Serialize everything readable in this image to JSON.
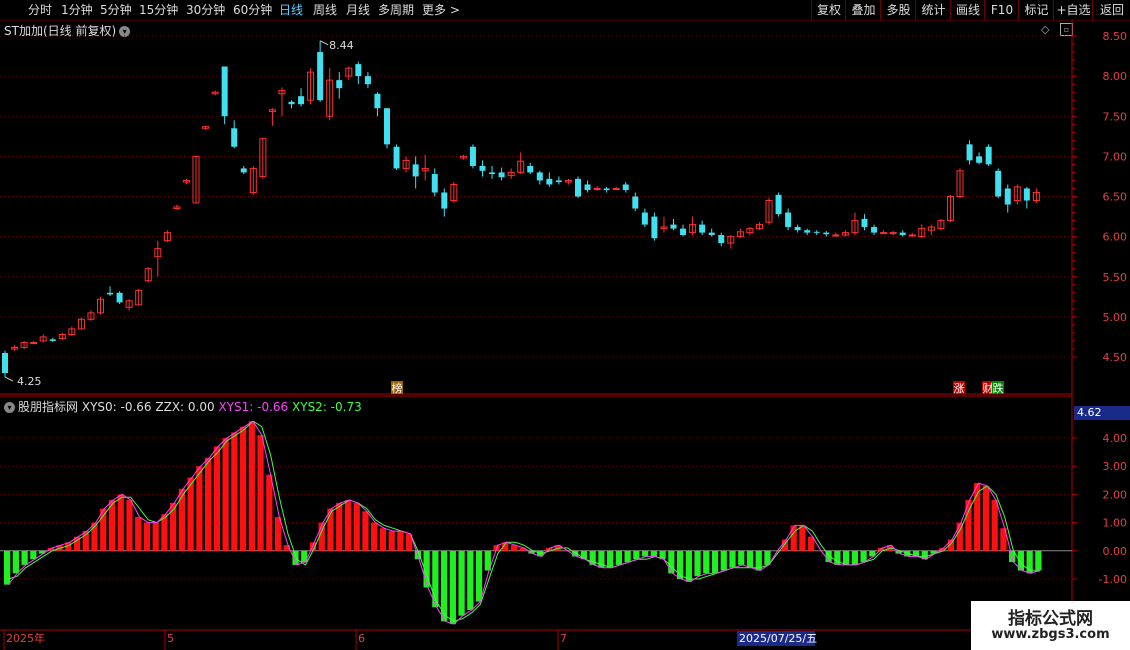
{
  "toolbar": {
    "tabs": [
      "分时",
      "1分钟",
      "5分钟",
      "15分钟",
      "30分钟",
      "60分钟",
      "日线",
      "周线",
      "月线",
      "多周期",
      "更多"
    ],
    "active_tab": "日线",
    "more_arrow": ">",
    "right_buttons": [
      "复权",
      "叠加",
      "多股",
      "统计",
      "画线",
      "F10",
      "标记",
      "+自选",
      "返回"
    ]
  },
  "main_chart": {
    "title": "ST加加(日线 前复权)",
    "high_label": "8.44",
    "low_label": "4.25",
    "y_ticks": [
      "8.50",
      "8.00",
      "7.50",
      "7.00",
      "6.50",
      "6.00",
      "5.50",
      "5.00",
      "4.50"
    ],
    "markers": [
      {
        "text": "榜",
        "color": "#e0a000"
      },
      {
        "text": "涨",
        "color": "#ff3030"
      },
      {
        "text": "财",
        "color": "#ff3030"
      },
      {
        "text": "跌",
        "color": "#00ff20"
      }
    ]
  },
  "indicator": {
    "name": "股朋指标网",
    "xys0": "XYS0: -0.66",
    "zzx": "ZZX: 0.00",
    "xys1": "XYS1: -0.66",
    "xys2": "XYS2: -0.73",
    "current_value": "4.62",
    "y_ticks": [
      "4.00",
      "3.00",
      "2.00",
      "1.00",
      "0.00",
      "-1.00"
    ]
  },
  "time_axis": {
    "labels": [
      "2025年",
      "5",
      "6",
      "7"
    ],
    "cursor_label": "2025/07/25/五"
  },
  "watermark": {
    "line1": "指标公式网",
    "line2": "www.zbgs3.com"
  },
  "colors": {
    "up": "#ff3030",
    "down": "#40e0f0",
    "hist_up": "#ff1010",
    "hist_down": "#20f020",
    "xys1": "#ff40ff",
    "xys2": "#40ff40",
    "axis": "#b00000"
  },
  "chart_data": {
    "type": "candlestick",
    "ylim": [
      4.2,
      8.6
    ],
    "candles": [
      [
        4.55,
        4.3,
        4.58,
        4.25
      ],
      [
        4.6,
        4.62,
        4.65,
        4.58
      ],
      [
        4.62,
        4.68,
        4.7,
        4.6
      ],
      [
        4.68,
        4.68,
        4.7,
        4.66
      ],
      [
        4.7,
        4.75,
        4.78,
        4.68
      ],
      [
        4.72,
        4.7,
        4.74,
        4.69
      ],
      [
        4.73,
        4.78,
        4.8,
        4.71
      ],
      [
        4.78,
        4.85,
        4.88,
        4.76
      ],
      [
        4.85,
        4.97,
        4.99,
        4.84
      ],
      [
        4.97,
        5.05,
        5.08,
        4.95
      ],
      [
        5.05,
        5.22,
        5.25,
        5.03
      ],
      [
        5.3,
        5.28,
        5.38,
        5.26
      ],
      [
        5.3,
        5.18,
        5.32,
        5.16
      ],
      [
        5.12,
        5.2,
        5.22,
        5.08
      ],
      [
        5.15,
        5.33,
        5.35,
        5.14
      ],
      [
        5.45,
        5.6,
        5.62,
        5.43
      ],
      [
        5.75,
        5.85,
        5.95,
        5.5
      ],
      [
        5.95,
        6.05,
        6.08,
        5.93
      ],
      [
        6.35,
        6.37,
        6.4,
        6.33
      ],
      [
        6.68,
        6.7,
        6.72,
        6.65
      ],
      [
        6.42,
        7.0,
        7.0,
        6.42
      ],
      [
        7.35,
        7.37,
        7.38,
        7.33
      ],
      [
        7.78,
        7.8,
        7.82,
        7.76
      ],
      [
        8.12,
        7.5,
        8.12,
        7.4
      ],
      [
        7.35,
        7.12,
        7.45,
        7.1
      ],
      [
        6.85,
        6.8,
        6.88,
        6.78
      ],
      [
        6.55,
        6.85,
        6.88,
        6.52
      ],
      [
        6.75,
        7.22,
        7.23,
        6.72
      ],
      [
        7.56,
        7.58,
        7.6,
        7.38
      ],
      [
        7.78,
        7.82,
        7.86,
        7.5
      ],
      [
        7.68,
        7.65,
        7.7,
        7.6
      ],
      [
        7.75,
        7.65,
        7.85,
        7.62
      ],
      [
        7.7,
        8.05,
        8.1,
        7.65
      ],
      [
        8.3,
        7.7,
        8.44,
        7.68
      ],
      [
        7.5,
        7.95,
        8.1,
        7.45
      ],
      [
        7.95,
        7.85,
        8.05,
        7.72
      ],
      [
        8.0,
        8.1,
        8.12,
        7.95
      ],
      [
        8.15,
        8.0,
        8.18,
        7.9
      ],
      [
        8.0,
        7.9,
        8.05,
        7.85
      ],
      [
        7.78,
        7.6,
        7.8,
        7.5
      ],
      [
        7.6,
        7.15,
        7.6,
        7.1
      ],
      [
        7.12,
        6.85,
        7.15,
        6.83
      ],
      [
        6.85,
        6.95,
        7.0,
        6.8
      ],
      [
        6.9,
        6.75,
        7.0,
        6.6
      ],
      [
        6.82,
        6.85,
        7.02,
        6.7
      ],
      [
        6.78,
        6.55,
        6.85,
        6.5
      ],
      [
        6.55,
        6.35,
        6.6,
        6.25
      ],
      [
        6.45,
        6.65,
        6.68,
        6.42
      ],
      [
        6.98,
        7.0,
        7.02,
        6.96
      ],
      [
        7.12,
        6.88,
        7.15,
        6.85
      ],
      [
        6.88,
        6.82,
        6.95,
        6.75
      ],
      [
        6.8,
        6.78,
        6.88,
        6.72
      ],
      [
        6.8,
        6.74,
        6.86,
        6.7
      ],
      [
        6.76,
        6.8,
        6.85,
        6.72
      ],
      [
        6.8,
        6.94,
        7.05,
        6.78
      ],
      [
        6.88,
        6.8,
        6.92,
        6.78
      ],
      [
        6.8,
        6.7,
        6.82,
        6.65
      ],
      [
        6.72,
        6.65,
        6.8,
        6.62
      ],
      [
        6.7,
        6.68,
        6.75,
        6.65
      ],
      [
        6.68,
        6.7,
        6.72,
        6.65
      ],
      [
        6.72,
        6.5,
        6.75,
        6.48
      ],
      [
        6.65,
        6.58,
        6.7,
        6.55
      ],
      [
        6.6,
        6.6,
        6.63,
        6.57
      ],
      [
        6.6,
        6.58,
        6.62,
        6.55
      ],
      [
        6.6,
        6.6,
        6.62,
        6.58
      ],
      [
        6.65,
        6.58,
        6.68,
        6.55
      ],
      [
        6.5,
        6.35,
        6.55,
        6.32
      ],
      [
        6.3,
        6.15,
        6.35,
        6.12
      ],
      [
        6.25,
        5.98,
        6.3,
        5.95
      ],
      [
        6.1,
        6.12,
        6.25,
        6.05
      ],
      [
        6.15,
        6.1,
        6.22,
        6.08
      ],
      [
        6.1,
        6.02,
        6.15,
        6.0
      ],
      [
        6.05,
        6.15,
        6.25,
        6.02
      ],
      [
        6.15,
        6.05,
        6.2,
        6.02
      ],
      [
        6.05,
        6.02,
        6.1,
        6.0
      ],
      [
        6.02,
        5.92,
        6.05,
        5.88
      ],
      [
        5.92,
        6.0,
        6.02,
        5.85
      ],
      [
        6.0,
        6.06,
        6.1,
        5.98
      ],
      [
        6.05,
        6.1,
        6.12,
        6.02
      ],
      [
        6.1,
        6.15,
        6.18,
        6.08
      ],
      [
        6.18,
        6.45,
        6.48,
        6.15
      ],
      [
        6.52,
        6.28,
        6.55,
        6.25
      ],
      [
        6.3,
        6.12,
        6.35,
        6.08
      ],
      [
        6.12,
        6.08,
        6.15,
        6.05
      ],
      [
        6.08,
        6.05,
        6.1,
        6.02
      ],
      [
        6.06,
        6.05,
        6.08,
        6.02
      ],
      [
        6.05,
        6.03,
        6.07,
        6.0
      ],
      [
        6.02,
        6.02,
        6.05,
        6.0
      ],
      [
        6.02,
        6.05,
        6.08,
        6.0
      ],
      [
        6.05,
        6.2,
        6.3,
        6.02
      ],
      [
        6.22,
        6.12,
        6.28,
        6.08
      ],
      [
        6.12,
        6.05,
        6.15,
        6.02
      ],
      [
        6.05,
        6.05,
        6.08,
        6.03
      ],
      [
        6.05,
        6.05,
        6.07,
        6.02
      ],
      [
        6.05,
        6.02,
        6.08,
        6.0
      ],
      [
        6.02,
        6.02,
        6.05,
        6.0
      ],
      [
        6.0,
        6.1,
        6.15,
        5.98
      ],
      [
        6.08,
        6.12,
        6.15,
        6.02
      ],
      [
        6.1,
        6.2,
        6.22,
        6.08
      ],
      [
        6.2,
        6.5,
        6.52,
        6.18
      ],
      [
        6.5,
        6.82,
        6.85,
        6.48
      ],
      [
        7.15,
        6.95,
        7.2,
        6.9
      ],
      [
        7.0,
        6.92,
        7.05,
        6.9
      ],
      [
        7.12,
        6.9,
        7.15,
        6.88
      ],
      [
        6.82,
        6.5,
        6.85,
        6.48
      ],
      [
        6.6,
        6.4,
        6.65,
        6.3
      ],
      [
        6.45,
        6.62,
        6.65,
        6.4
      ],
      [
        6.6,
        6.45,
        6.62,
        6.35
      ],
      [
        6.45,
        6.55,
        6.6,
        6.42
      ]
    ],
    "indicator_series": [
      {
        "name": "XYS1",
        "values": [
          -1.2,
          -0.8,
          -0.5,
          -0.3,
          -0.1,
          0.1,
          0.2,
          0.3,
          0.5,
          0.7,
          1.0,
          1.5,
          1.8,
          2.0,
          1.8,
          1.2,
          1.0,
          1.0,
          1.3,
          1.7,
          2.2,
          2.6,
          3.0,
          3.3,
          3.7,
          4.0,
          4.2,
          4.4,
          4.6,
          4.1,
          2.7,
          1.2,
          0.2,
          -0.5,
          -0.4,
          0.3,
          1.0,
          1.5,
          1.7,
          1.8,
          1.7,
          1.4,
          1.0,
          0.8,
          0.7,
          0.7,
          0.6,
          -0.3,
          -1.3,
          -2.0,
          -2.5,
          -2.6,
          -2.3,
          -2.1,
          -1.8,
          -0.7,
          0.2,
          0.3,
          0.2,
          0.1,
          -0.1,
          -0.2,
          0.1,
          0.2,
          0.0,
          -0.2,
          -0.3,
          -0.5,
          -0.6,
          -0.6,
          -0.5,
          -0.4,
          -0.3,
          -0.2,
          -0.2,
          -0.3,
          -0.8,
          -1.0,
          -1.1,
          -0.9,
          -0.8,
          -0.8,
          -0.7,
          -0.6,
          -0.5,
          -0.6,
          -0.7,
          -0.5,
          0.0,
          0.4,
          0.9,
          0.9,
          0.5,
          0.0,
          -0.4,
          -0.5,
          -0.5,
          -0.5,
          -0.4,
          -0.2,
          0.1,
          0.2,
          -0.1,
          -0.2,
          -0.2,
          -0.3,
          -0.1,
          0.1,
          0.4,
          1.0,
          1.8,
          2.4,
          2.3,
          1.8,
          0.8,
          -0.4,
          -0.7,
          -0.8,
          -0.7
        ]
      },
      {
        "name": "XYS2",
        "values": [
          -1.0,
          -0.9,
          -0.6,
          -0.4,
          -0.2,
          0.0,
          0.1,
          0.2,
          0.4,
          0.6,
          0.9,
          1.3,
          1.7,
          1.9,
          1.9,
          1.5,
          1.1,
          1.0,
          1.2,
          1.5,
          2.0,
          2.4,
          2.8,
          3.2,
          3.5,
          3.9,
          4.1,
          4.3,
          4.6,
          4.4,
          3.4,
          1.9,
          0.6,
          -0.3,
          -0.5,
          0.1,
          0.8,
          1.4,
          1.6,
          1.8,
          1.7,
          1.5,
          1.1,
          0.9,
          0.8,
          0.7,
          0.6,
          -0.1,
          -1.0,
          -1.8,
          -2.3,
          -2.5,
          -2.4,
          -2.2,
          -1.9,
          -1.0,
          -0.1,
          0.3,
          0.3,
          0.2,
          0.0,
          -0.1,
          0.0,
          0.1,
          0.1,
          -0.1,
          -0.3,
          -0.4,
          -0.5,
          -0.6,
          -0.5,
          -0.4,
          -0.3,
          -0.3,
          -0.2,
          -0.3,
          -0.6,
          -0.9,
          -1.0,
          -1.0,
          -0.9,
          -0.8,
          -0.7,
          -0.6,
          -0.6,
          -0.6,
          -0.6,
          -0.5,
          -0.1,
          0.3,
          0.7,
          0.9,
          0.7,
          0.2,
          -0.2,
          -0.4,
          -0.5,
          -0.5,
          -0.4,
          -0.3,
          0.0,
          0.1,
          0.0,
          -0.1,
          -0.2,
          -0.2,
          -0.1,
          0.0,
          0.3,
          0.8,
          1.5,
          2.1,
          2.3,
          2.0,
          1.2,
          0.0,
          -0.5,
          -0.7,
          -0.73
        ]
      }
    ]
  }
}
